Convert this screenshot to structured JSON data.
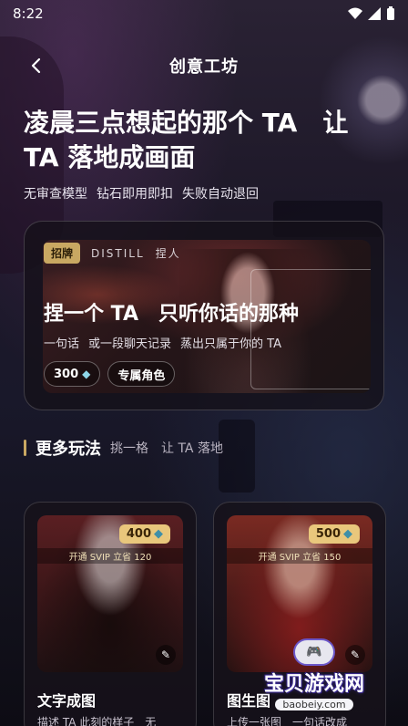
{
  "status_bar": {
    "time": "8:22"
  },
  "header": {
    "title": "创意工坊",
    "back_icon": "chevron-left-icon"
  },
  "hero": {
    "title": "凌晨三点想起的那个 TA　让 TA 落地成画面",
    "subtitles": [
      "无审查模型",
      "钻石即用即扣",
      "失败自动退回"
    ]
  },
  "feature": {
    "badge": "招牌",
    "tags": [
      "DISTILL",
      "捏人"
    ],
    "title": "捏一个 TA　只听你话的那种",
    "desc": [
      "一句话",
      "或一段聊天记录",
      "蒸出只属于你的 TA"
    ],
    "price": "300",
    "chip_label": "专属角色"
  },
  "more": {
    "title": "更多玩法",
    "subtitle": "挑一格　让 TA 落地"
  },
  "cards": [
    {
      "price": "400",
      "svip_note": "开通 SVIP 立省 120",
      "title": "文字成图",
      "desc": "描述 TA 此刻的样子　无"
    },
    {
      "price": "500",
      "svip_note": "开通 SVIP 立省 150",
      "title": "图生图",
      "desc": "上传一张图　一句话改成"
    }
  ],
  "watermark": {
    "name": "宝贝游戏网",
    "url": "baobeiy.com"
  },
  "colors": {
    "accent_gold": "#c9a862",
    "badge_gold": "#e9c77c",
    "diamond": "#8ed6e8"
  }
}
